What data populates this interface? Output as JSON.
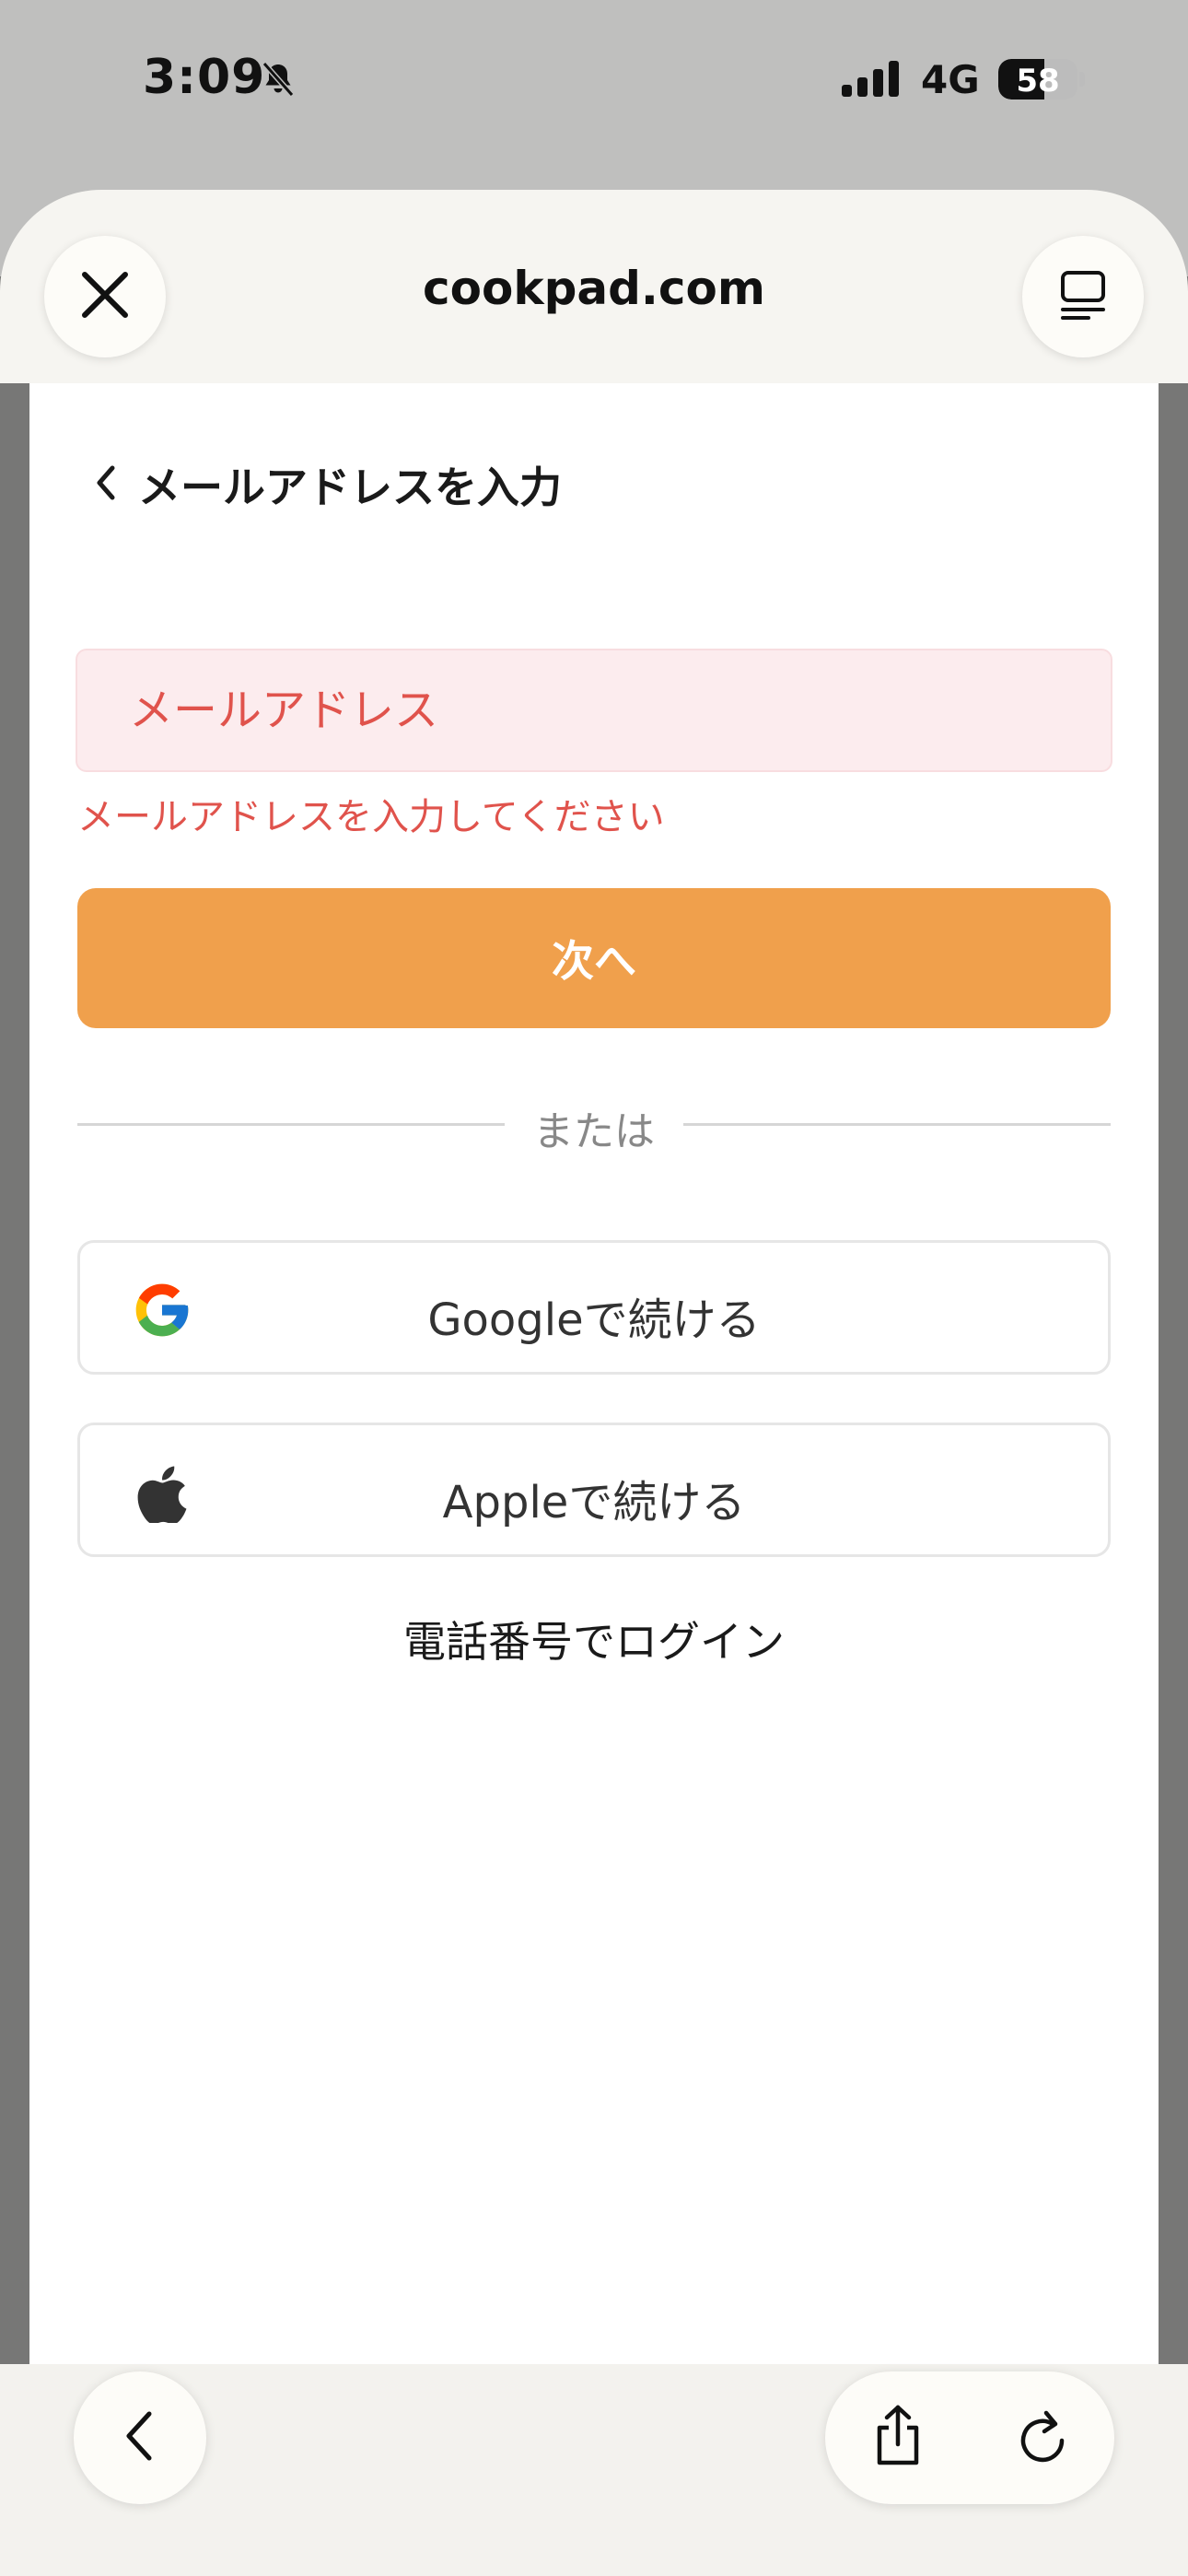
{
  "status_bar": {
    "time": "3:09",
    "network": "4G",
    "battery_percent": 58,
    "battery_label": "58",
    "silent_icon": "bell-slash-icon",
    "signal_icon": "cellular-signal-icon"
  },
  "browser": {
    "url": "cookpad.com",
    "close_icon": "close-icon",
    "reader_icon": "reader-mode-icon"
  },
  "page": {
    "back_icon": "chevron-left-icon",
    "title": "メールアドレスを入力",
    "email": {
      "placeholder": "メールアドレス",
      "value": "",
      "error": "メールアドレスを入力してください"
    },
    "next_label": "次へ",
    "divider_label": "または",
    "google_label": "Googleで続ける",
    "google_icon": "google-logo-icon",
    "apple_label": "Appleで続ける",
    "apple_icon": "apple-logo-icon",
    "phone_login_label": "電話番号でログイン"
  },
  "toolbar": {
    "back_icon": "chevron-left-icon",
    "share_icon": "share-icon",
    "reload_icon": "reload-icon"
  },
  "colors": {
    "accent": "#f0a04c",
    "error": "#e0534c",
    "error_bg": "#fcecee"
  }
}
